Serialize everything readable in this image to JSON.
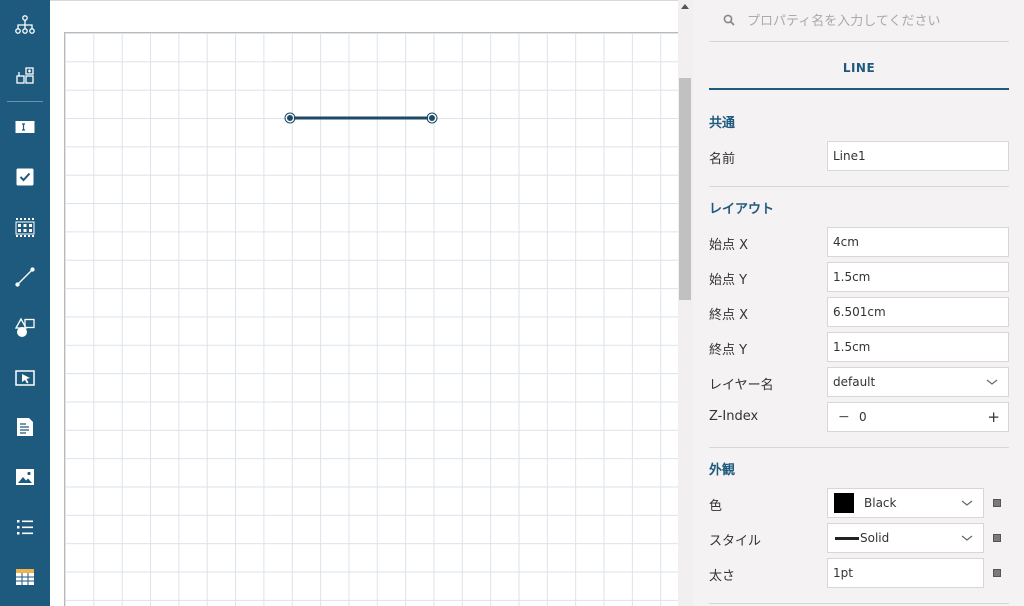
{
  "toolbar": {
    "tools": [
      {
        "icon": "hierarchy-icon"
      },
      {
        "icon": "add-component-icon"
      },
      {
        "icon": "textbox-icon"
      },
      {
        "icon": "checkbox-icon"
      },
      {
        "icon": "barcode-icon"
      },
      {
        "icon": "line-icon"
      },
      {
        "icon": "shapes-icon"
      },
      {
        "icon": "select-area-icon"
      },
      {
        "icon": "document-icon"
      },
      {
        "icon": "image-icon"
      },
      {
        "icon": "list-icon"
      },
      {
        "icon": "table-icon"
      }
    ]
  },
  "colors": {
    "accent": "#1d5a7d",
    "panel_bg": "#f4f2f3",
    "line_color": "#1d4a66"
  },
  "panel": {
    "search_placeholder": "プロパティ名を入力してください",
    "tab_label": "LINE",
    "common": {
      "title": "共通",
      "name_label": "名前",
      "name_value": "Line1"
    },
    "layout": {
      "title": "レイアウト",
      "start_x_label": "始点 X",
      "start_x_value": "4cm",
      "start_y_label": "始点 Y",
      "start_y_value": "1.5cm",
      "end_x_label": "終点 X",
      "end_x_value": "6.501cm",
      "end_y_label": "終点 Y",
      "end_y_value": "1.5cm",
      "layer_label": "レイヤー名",
      "layer_value": "default",
      "zindex_label": "Z-Index",
      "zindex_value": "0",
      "minus": "−",
      "plus": "+"
    },
    "appearance": {
      "title": "外観",
      "color_label": "色",
      "color_value": "Black",
      "style_label": "スタイル",
      "style_value": "Solid",
      "width_label": "太さ",
      "width_value": "1pt"
    }
  }
}
